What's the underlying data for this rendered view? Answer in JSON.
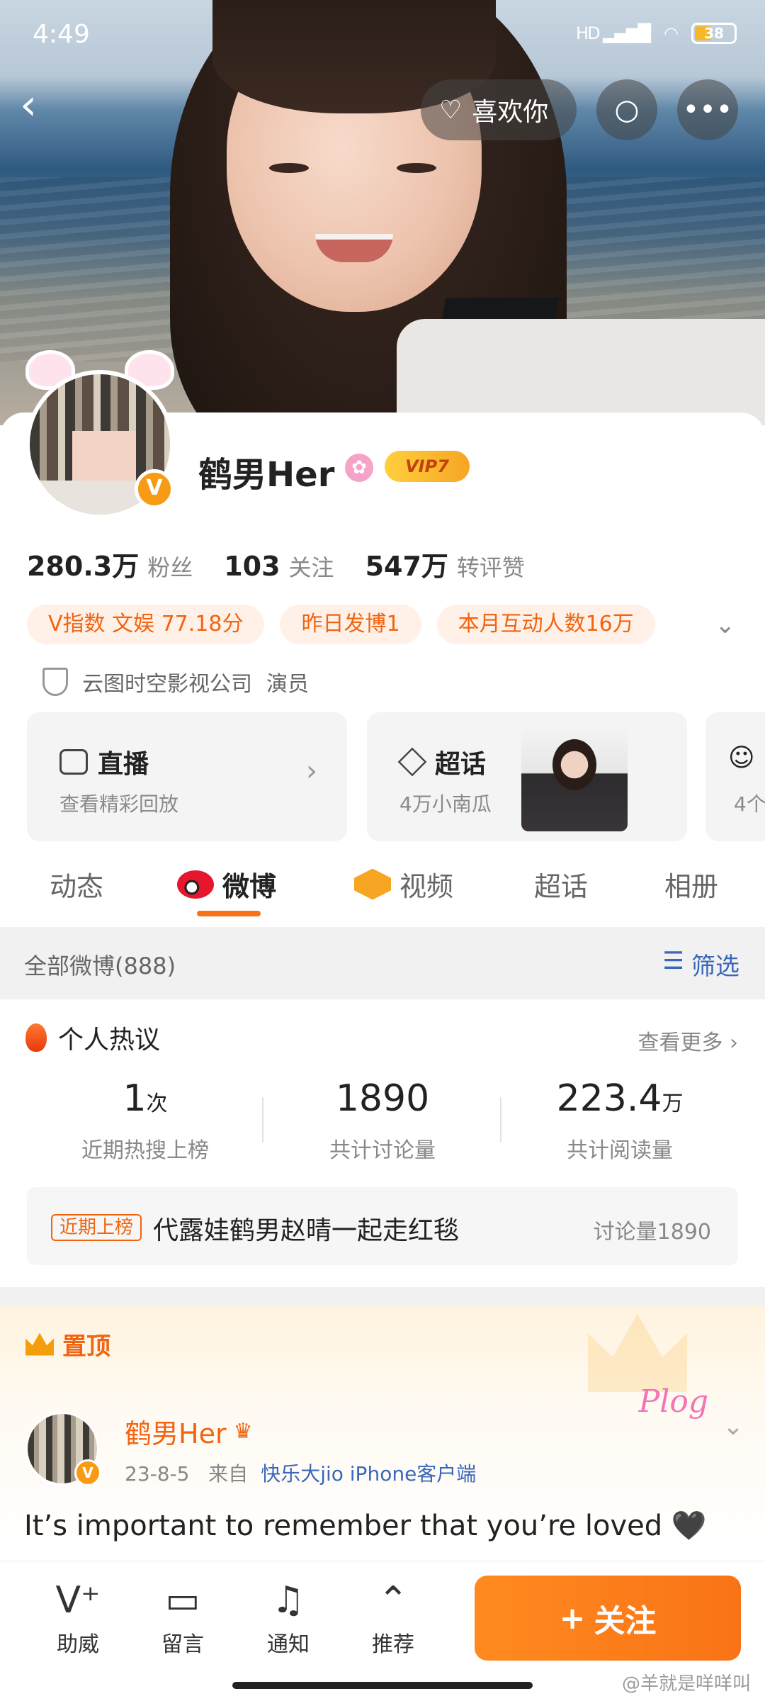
{
  "status": {
    "time": "4:49",
    "network": "HD",
    "battery": "38"
  },
  "header": {
    "like_label": "喜欢你"
  },
  "profile": {
    "name": "鹤男Her",
    "vip": "VIP7",
    "stats": [
      {
        "num": "280.3万",
        "label": "粉丝"
      },
      {
        "num": "103",
        "label": "关注"
      },
      {
        "num": "547万",
        "label": "转评赞"
      }
    ],
    "tags": [
      "V指数 文娱 77.18分",
      "昨日发博1",
      "本月互动人数16万"
    ],
    "company": "云图时空影视公司",
    "role": "演员"
  },
  "entries": [
    {
      "title": "直播",
      "sub": "查看精彩回放"
    },
    {
      "title": "超话",
      "sub": "4万小南瓜"
    },
    {
      "title": "",
      "sub": "4个"
    }
  ],
  "tabs": [
    "动态",
    "微博",
    "视频",
    "超话",
    "相册"
  ],
  "filter": {
    "all": "全部微博(888)",
    "filter": "筛选"
  },
  "hot": {
    "title": "个人热议",
    "more": "查看更多",
    "stats": [
      {
        "big": "1",
        "unit": "次",
        "cap": "近期热搜上榜"
      },
      {
        "big": "1890",
        "unit": "",
        "cap": "共计讨论量"
      },
      {
        "big": "223.4",
        "unit": "万",
        "cap": "共计阅读量"
      }
    ],
    "trend": {
      "badge": "近期上榜",
      "text": "代露娃鹤男赵晴一起走红毯",
      "count": "讨论量1890"
    }
  },
  "pinned": {
    "label": "置顶",
    "author": "鹤男Her",
    "date": "23-8-5",
    "from": "来自",
    "source": "快乐大jio iPhone客户端",
    "sticker": "Plog",
    "text": "It’s important to remember that you’re loved 🖤"
  },
  "bottom": {
    "items": [
      "助威",
      "留言",
      "通知",
      "推荐"
    ],
    "follow": "关注",
    "watermark": "@羊就是咩咩叫"
  }
}
